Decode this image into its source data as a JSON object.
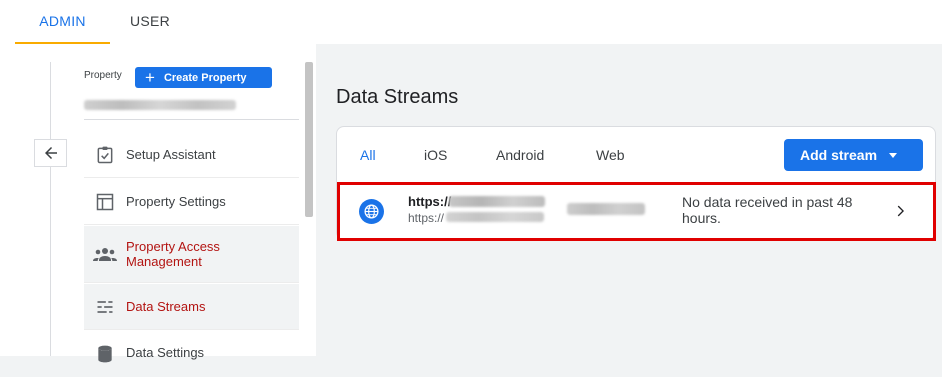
{
  "top_tabs": [
    {
      "label": "ADMIN",
      "active": true
    },
    {
      "label": "USER",
      "active": false
    }
  ],
  "sidebar": {
    "property_label": "Property",
    "create_button": "Create Property",
    "back_icon": "arrow-left-icon",
    "items": [
      {
        "label": "Setup Assistant",
        "icon": "checklist-icon",
        "active": false
      },
      {
        "label": "Property Settings",
        "icon": "property-settings-icon",
        "active": false
      },
      {
        "label": "Property Access Management",
        "icon": "people-icon",
        "active": true
      },
      {
        "label": "Data Streams",
        "icon": "data-streams-icon",
        "active": true
      },
      {
        "label": "Data Settings",
        "icon": "database-icon",
        "active": false
      }
    ]
  },
  "main": {
    "title": "Data Streams",
    "filter_tabs": [
      {
        "label": "All",
        "active": true
      },
      {
        "label": "iOS",
        "active": false
      },
      {
        "label": "Android",
        "active": false
      },
      {
        "label": "Web",
        "active": false
      }
    ],
    "add_stream_label": "Add stream",
    "stream": {
      "url_prefix": "https://",
      "url_prefix_2": "https://",
      "status": "No data received in past 48 hours.",
      "icon": "globe-icon"
    }
  },
  "colors": {
    "accent": "#1a73e8",
    "tab_underline": "#f9ab00",
    "active_nav_text": "#b31412",
    "highlight_border": "#e00000"
  }
}
